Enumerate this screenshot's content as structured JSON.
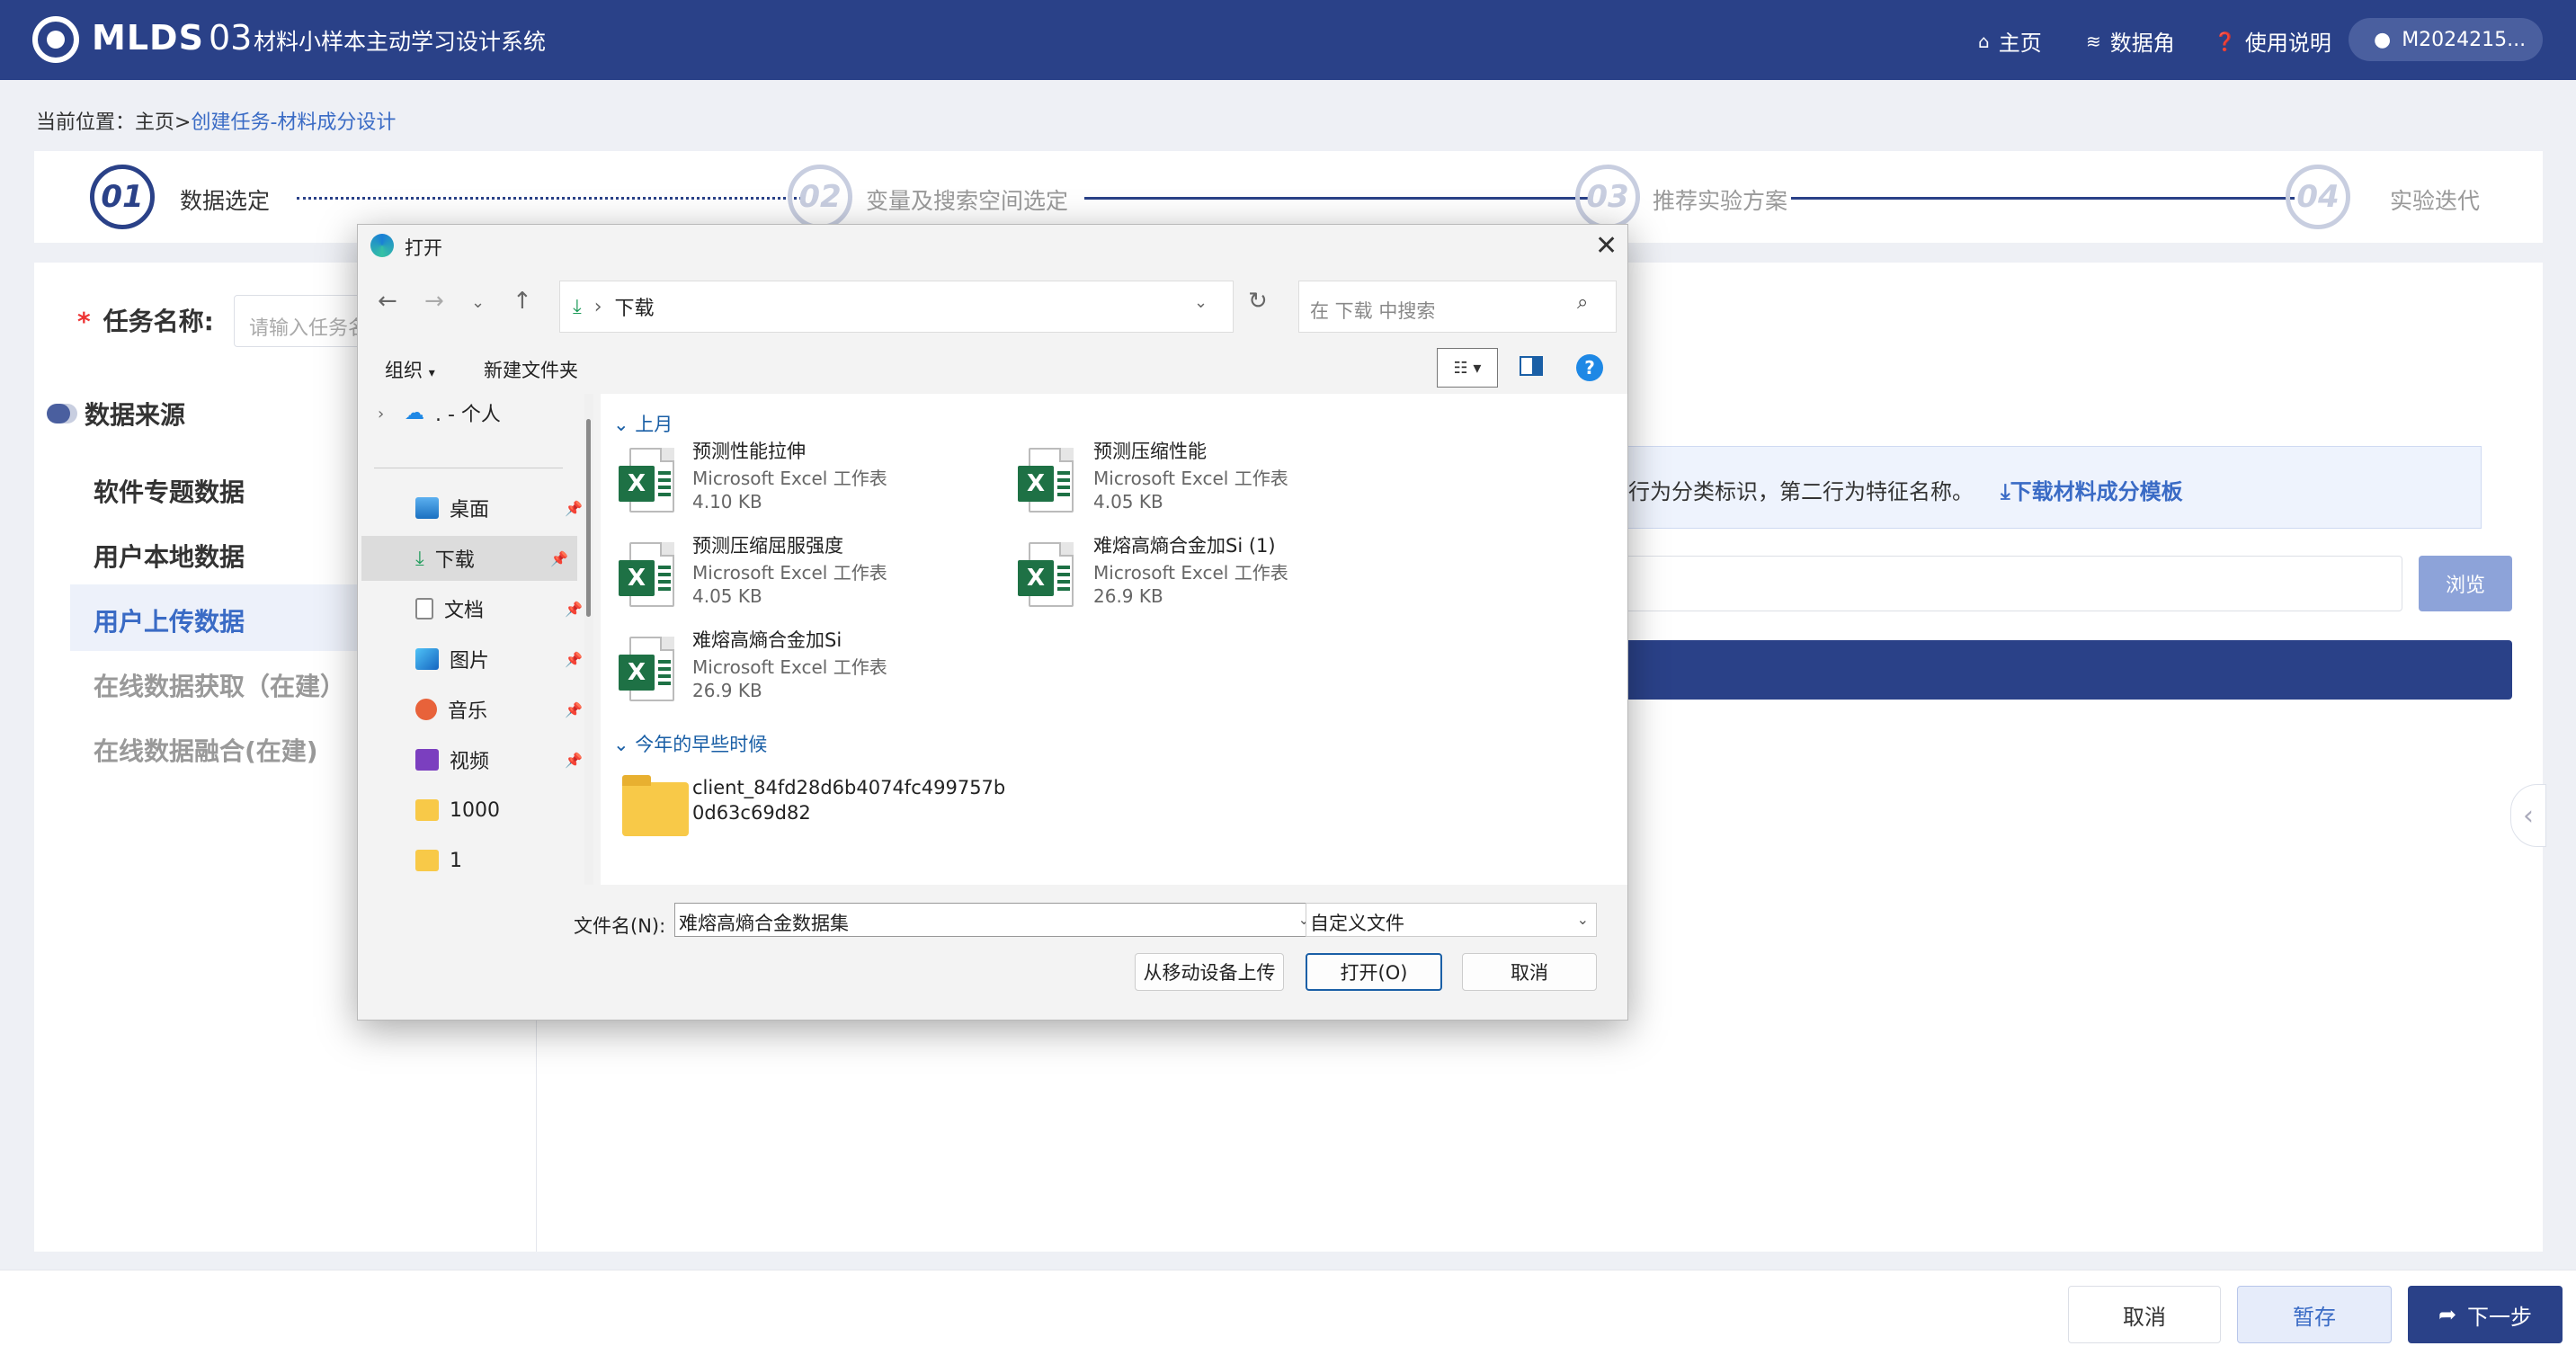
{
  "header": {
    "logo_text": "MLDS",
    "logo_num": "03",
    "app_title": "材料小样本主动学习设计系统",
    "nav": [
      {
        "label": "主页",
        "icon": "home-icon"
      },
      {
        "label": "数据角",
        "icon": "layers-icon"
      },
      {
        "label": "使用说明",
        "icon": "help-circle-icon"
      }
    ],
    "user": "M2024215..."
  },
  "breadcrumb": {
    "prefix": "当前位置：",
    "home": "主页>",
    "current": "创建任务-材料成分设计"
  },
  "stepper": {
    "steps": [
      {
        "num": "01",
        "label": "数据选定",
        "active": true
      },
      {
        "num": "02",
        "label": "变量及搜索空间选定",
        "active": false
      },
      {
        "num": "03",
        "label": "推荐实验方案",
        "active": false
      },
      {
        "num": "04",
        "label": "实验迭代",
        "active": false
      }
    ]
  },
  "form": {
    "required_mark": "*",
    "task_label": "任务名称:",
    "task_placeholder": "请输入任务名"
  },
  "sources": {
    "title": "数据来源",
    "items": [
      {
        "label": "软件专题数据",
        "state": "normal"
      },
      {
        "label": "用户本地数据",
        "state": "normal"
      },
      {
        "label": "用户上传数据",
        "state": "active"
      },
      {
        "label": "在线数据获取（在建）",
        "state": "disabled"
      },
      {
        "label": "在线数据融合(在建)",
        "state": "disabled"
      }
    ]
  },
  "upload": {
    "notice": "行为分类标识，第二行为特征名称。",
    "download_link": "⤓下载材料成分模板",
    "browse": "浏览"
  },
  "footer": {
    "cancel": "取消",
    "save": "暂存",
    "next": "下一步"
  },
  "dialog": {
    "title": "打开",
    "address": "下载",
    "search_placeholder": "在 下载 中搜索",
    "organize": "组织",
    "new_folder": "新建文件夹",
    "help": "?",
    "sidebar": [
      {
        "label": ". - 个人",
        "icon": "onedrive-cloud-icon",
        "pinned": false
      },
      {
        "label": "桌面",
        "icon": "desktop-icon",
        "pinned": true
      },
      {
        "label": "下载",
        "icon": "download-icon",
        "pinned": true
      },
      {
        "label": "文档",
        "icon": "document-icon",
        "pinned": true
      },
      {
        "label": "图片",
        "icon": "pictures-icon",
        "pinned": true
      },
      {
        "label": "音乐",
        "icon": "music-icon",
        "pinned": true
      },
      {
        "label": "视频",
        "icon": "video-icon",
        "pinned": true
      },
      {
        "label": "1000",
        "icon": "folder-icon",
        "pinned": false
      },
      {
        "label": "1",
        "icon": "folder-icon",
        "pinned": false
      }
    ],
    "groups": [
      {
        "name": "上月",
        "files": [
          {
            "name": "预测性能拉伸",
            "type": "Microsoft Excel 工作表",
            "size": "4.10 KB"
          },
          {
            "name": "预测压缩性能",
            "type": "Microsoft Excel 工作表",
            "size": "4.05 KB"
          },
          {
            "name": "预测压缩屈服强度",
            "type": "Microsoft Excel 工作表",
            "size": "4.05 KB"
          },
          {
            "name": "难熔高熵合金加Si (1)",
            "type": "Microsoft Excel 工作表",
            "size": "26.9 KB"
          },
          {
            "name": "难熔高熵合金加Si",
            "type": "Microsoft Excel 工作表",
            "size": "26.9 KB"
          }
        ]
      },
      {
        "name": "今年的早些时候",
        "folders": [
          {
            "name_line1": "client_84fd28d6b4074fc499757b",
            "name_line2": "0d63c69d82"
          }
        ]
      }
    ],
    "filename_label": "文件名(N):",
    "filename_value": "难熔高熵合金数据集",
    "filetype_value": "自定义文件",
    "btn_mobile": "从移动设备上传",
    "btn_open": "打开(O)",
    "btn_cancel": "取消"
  },
  "colors": {
    "brand": "#2a4188",
    "accent": "#3a6bc5",
    "excel": "#1e7145"
  }
}
